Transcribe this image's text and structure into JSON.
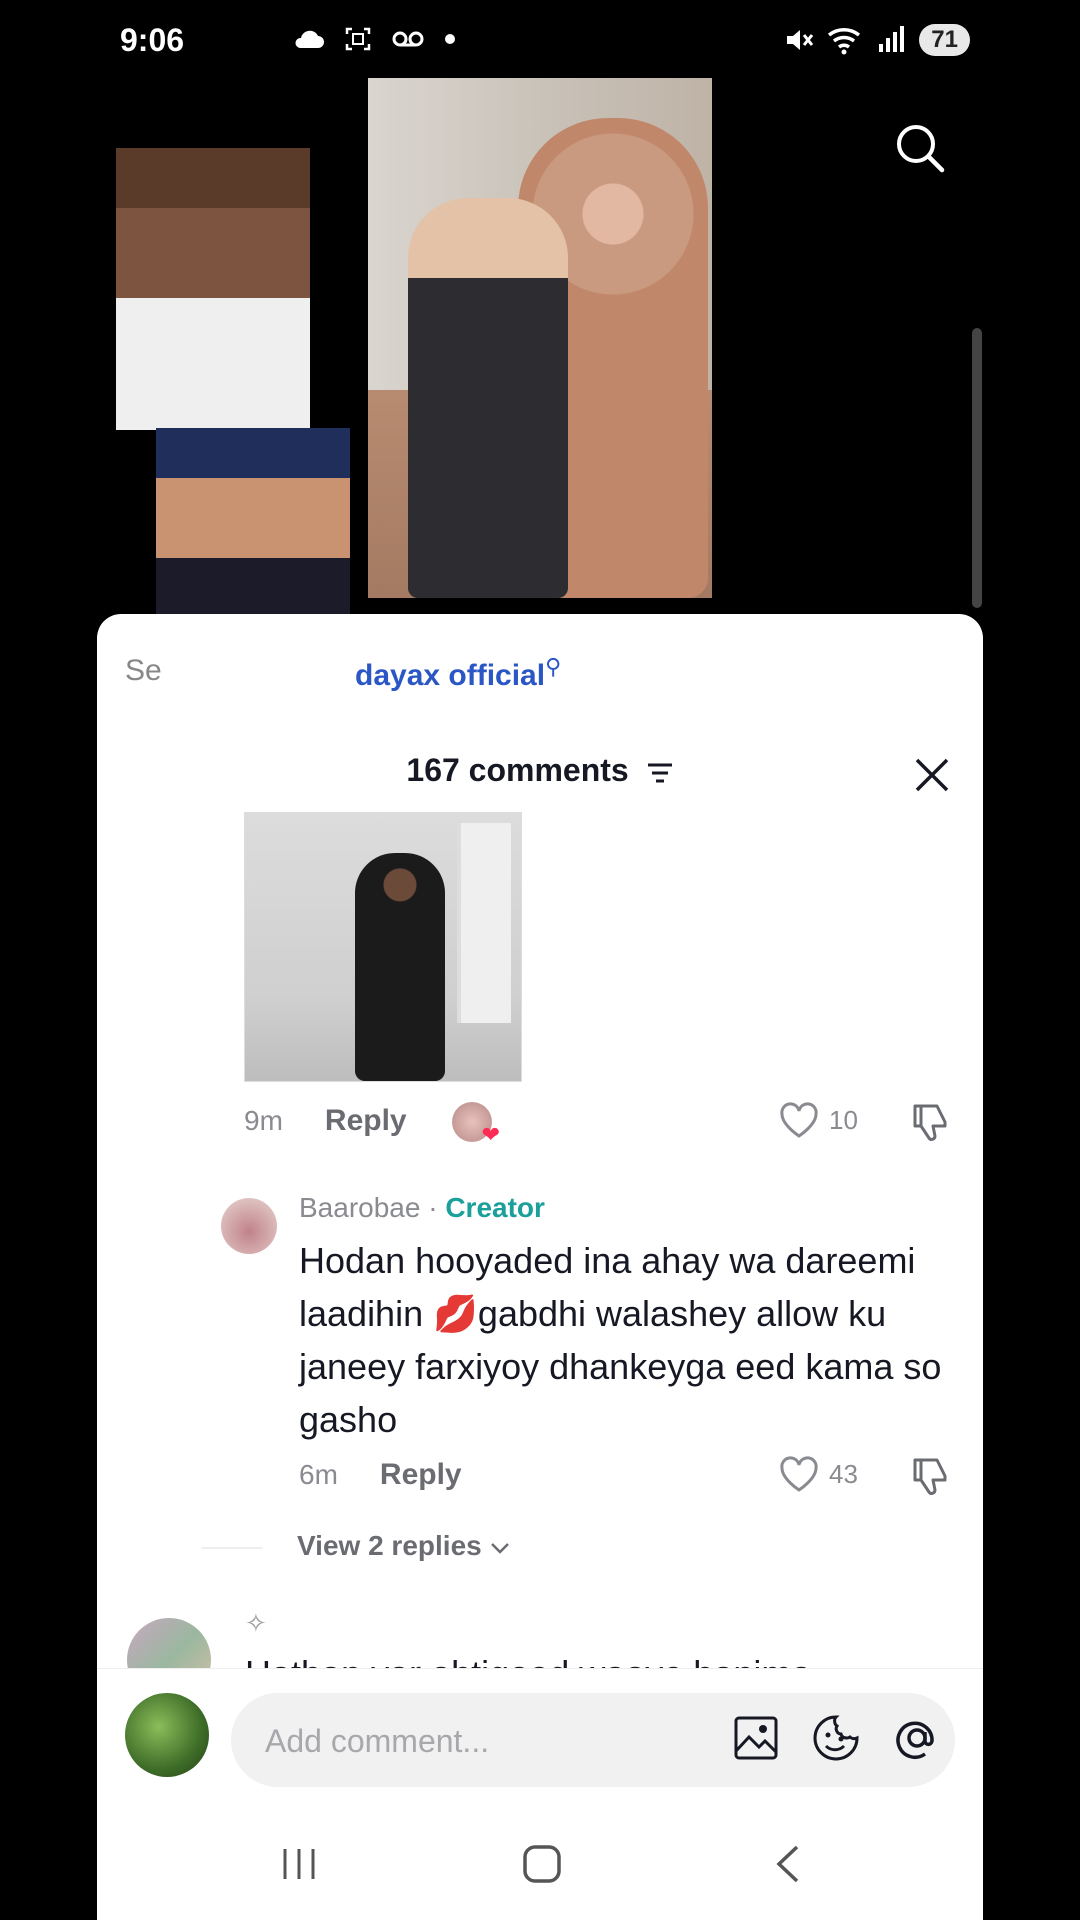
{
  "status_bar": {
    "time": "9:06",
    "battery": "71",
    "icons": [
      "cloud-icon",
      "screenshot-icon",
      "voicemail-icon",
      "dot-icon",
      "mute-icon",
      "wifi-icon",
      "signal-icon",
      "battery-icon"
    ]
  },
  "video": {
    "search_icon": "search-icon"
  },
  "search_suggestion": {
    "prefix": "Se",
    "query": "dayax official"
  },
  "comments": {
    "count_label": "167 comments",
    "top_comment": {
      "time": "9m",
      "reply_label": "Reply",
      "likes": "10"
    },
    "reply": {
      "author": "Baarobae",
      "separator": " · ",
      "badge": "Creator",
      "text": "Hodan hooyaded ina ahay wa dareemi laadihin 💋gabdhi walashey allow ku janeey farxiyoy dhankeyga eed kama so gasho",
      "time": "6m",
      "reply_label": "Reply",
      "likes": "43"
    },
    "view_replies": "View 2 replies",
    "partial_text": "Hathan yar ahtigood waaye hanima"
  },
  "input": {
    "placeholder": "Add comment..."
  },
  "colors": {
    "accent_link": "#2b56c5",
    "creator_badge": "#1a9f9a",
    "like_heart": "#fe2c55"
  }
}
